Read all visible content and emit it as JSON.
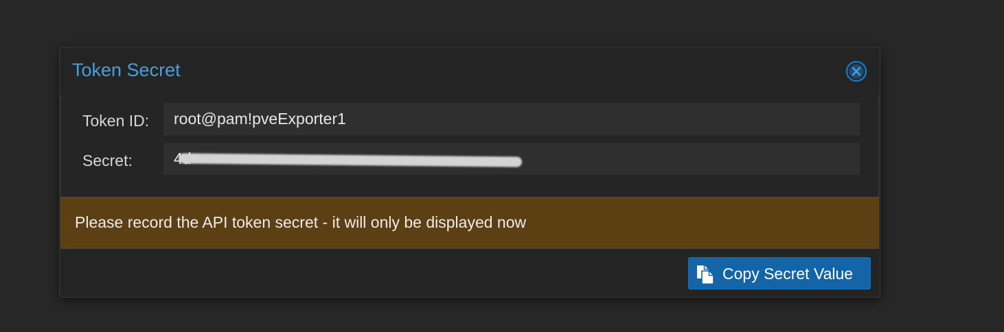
{
  "dialog": {
    "title": "Token Secret",
    "close_icon": "close-circle-icon",
    "fields": {
      "token_id": {
        "label": "Token ID:",
        "value": "root@pam!pveExporter1"
      },
      "secret": {
        "label": "Secret:",
        "value": "4d",
        "redacted": true
      }
    },
    "warning": {
      "text": "Please record the API token secret - it will only be displayed now",
      "color": "#5c3f12"
    },
    "footer": {
      "copy_button_label": "Copy Secret Value",
      "copy_icon": "copy-icon",
      "button_color": "#1365a8"
    }
  },
  "colors": {
    "accent": "#4a9ede",
    "background": "#272727"
  }
}
